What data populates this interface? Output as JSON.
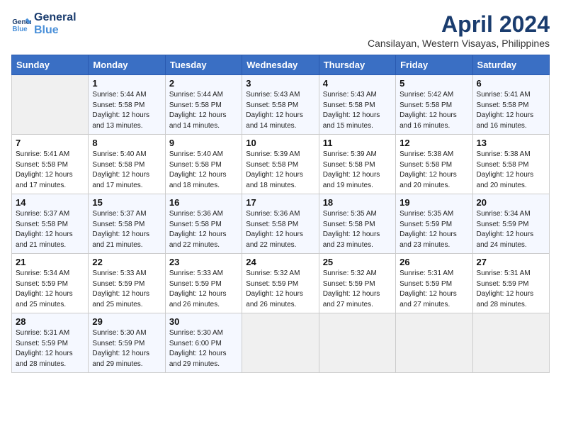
{
  "header": {
    "logo_line1": "General",
    "logo_line2": "Blue",
    "month_title": "April 2024",
    "subtitle": "Cansilayan, Western Visayas, Philippines"
  },
  "weekdays": [
    "Sunday",
    "Monday",
    "Tuesday",
    "Wednesday",
    "Thursday",
    "Friday",
    "Saturday"
  ],
  "weeks": [
    [
      {
        "day": "",
        "info": ""
      },
      {
        "day": "1",
        "info": "Sunrise: 5:44 AM\nSunset: 5:58 PM\nDaylight: 12 hours\nand 13 minutes."
      },
      {
        "day": "2",
        "info": "Sunrise: 5:44 AM\nSunset: 5:58 PM\nDaylight: 12 hours\nand 14 minutes."
      },
      {
        "day": "3",
        "info": "Sunrise: 5:43 AM\nSunset: 5:58 PM\nDaylight: 12 hours\nand 14 minutes."
      },
      {
        "day": "4",
        "info": "Sunrise: 5:43 AM\nSunset: 5:58 PM\nDaylight: 12 hours\nand 15 minutes."
      },
      {
        "day": "5",
        "info": "Sunrise: 5:42 AM\nSunset: 5:58 PM\nDaylight: 12 hours\nand 16 minutes."
      },
      {
        "day": "6",
        "info": "Sunrise: 5:41 AM\nSunset: 5:58 PM\nDaylight: 12 hours\nand 16 minutes."
      }
    ],
    [
      {
        "day": "7",
        "info": "Sunrise: 5:41 AM\nSunset: 5:58 PM\nDaylight: 12 hours\nand 17 minutes."
      },
      {
        "day": "8",
        "info": "Sunrise: 5:40 AM\nSunset: 5:58 PM\nDaylight: 12 hours\nand 17 minutes."
      },
      {
        "day": "9",
        "info": "Sunrise: 5:40 AM\nSunset: 5:58 PM\nDaylight: 12 hours\nand 18 minutes."
      },
      {
        "day": "10",
        "info": "Sunrise: 5:39 AM\nSunset: 5:58 PM\nDaylight: 12 hours\nand 18 minutes."
      },
      {
        "day": "11",
        "info": "Sunrise: 5:39 AM\nSunset: 5:58 PM\nDaylight: 12 hours\nand 19 minutes."
      },
      {
        "day": "12",
        "info": "Sunrise: 5:38 AM\nSunset: 5:58 PM\nDaylight: 12 hours\nand 20 minutes."
      },
      {
        "day": "13",
        "info": "Sunrise: 5:38 AM\nSunset: 5:58 PM\nDaylight: 12 hours\nand 20 minutes."
      }
    ],
    [
      {
        "day": "14",
        "info": "Sunrise: 5:37 AM\nSunset: 5:58 PM\nDaylight: 12 hours\nand 21 minutes."
      },
      {
        "day": "15",
        "info": "Sunrise: 5:37 AM\nSunset: 5:58 PM\nDaylight: 12 hours\nand 21 minutes."
      },
      {
        "day": "16",
        "info": "Sunrise: 5:36 AM\nSunset: 5:58 PM\nDaylight: 12 hours\nand 22 minutes."
      },
      {
        "day": "17",
        "info": "Sunrise: 5:36 AM\nSunset: 5:58 PM\nDaylight: 12 hours\nand 22 minutes."
      },
      {
        "day": "18",
        "info": "Sunrise: 5:35 AM\nSunset: 5:58 PM\nDaylight: 12 hours\nand 23 minutes."
      },
      {
        "day": "19",
        "info": "Sunrise: 5:35 AM\nSunset: 5:59 PM\nDaylight: 12 hours\nand 23 minutes."
      },
      {
        "day": "20",
        "info": "Sunrise: 5:34 AM\nSunset: 5:59 PM\nDaylight: 12 hours\nand 24 minutes."
      }
    ],
    [
      {
        "day": "21",
        "info": "Sunrise: 5:34 AM\nSunset: 5:59 PM\nDaylight: 12 hours\nand 25 minutes."
      },
      {
        "day": "22",
        "info": "Sunrise: 5:33 AM\nSunset: 5:59 PM\nDaylight: 12 hours\nand 25 minutes."
      },
      {
        "day": "23",
        "info": "Sunrise: 5:33 AM\nSunset: 5:59 PM\nDaylight: 12 hours\nand 26 minutes."
      },
      {
        "day": "24",
        "info": "Sunrise: 5:32 AM\nSunset: 5:59 PM\nDaylight: 12 hours\nand 26 minutes."
      },
      {
        "day": "25",
        "info": "Sunrise: 5:32 AM\nSunset: 5:59 PM\nDaylight: 12 hours\nand 27 minutes."
      },
      {
        "day": "26",
        "info": "Sunrise: 5:31 AM\nSunset: 5:59 PM\nDaylight: 12 hours\nand 27 minutes."
      },
      {
        "day": "27",
        "info": "Sunrise: 5:31 AM\nSunset: 5:59 PM\nDaylight: 12 hours\nand 28 minutes."
      }
    ],
    [
      {
        "day": "28",
        "info": "Sunrise: 5:31 AM\nSunset: 5:59 PM\nDaylight: 12 hours\nand 28 minutes."
      },
      {
        "day": "29",
        "info": "Sunrise: 5:30 AM\nSunset: 5:59 PM\nDaylight: 12 hours\nand 29 minutes."
      },
      {
        "day": "30",
        "info": "Sunrise: 5:30 AM\nSunset: 6:00 PM\nDaylight: 12 hours\nand 29 minutes."
      },
      {
        "day": "",
        "info": ""
      },
      {
        "day": "",
        "info": ""
      },
      {
        "day": "",
        "info": ""
      },
      {
        "day": "",
        "info": ""
      }
    ]
  ]
}
